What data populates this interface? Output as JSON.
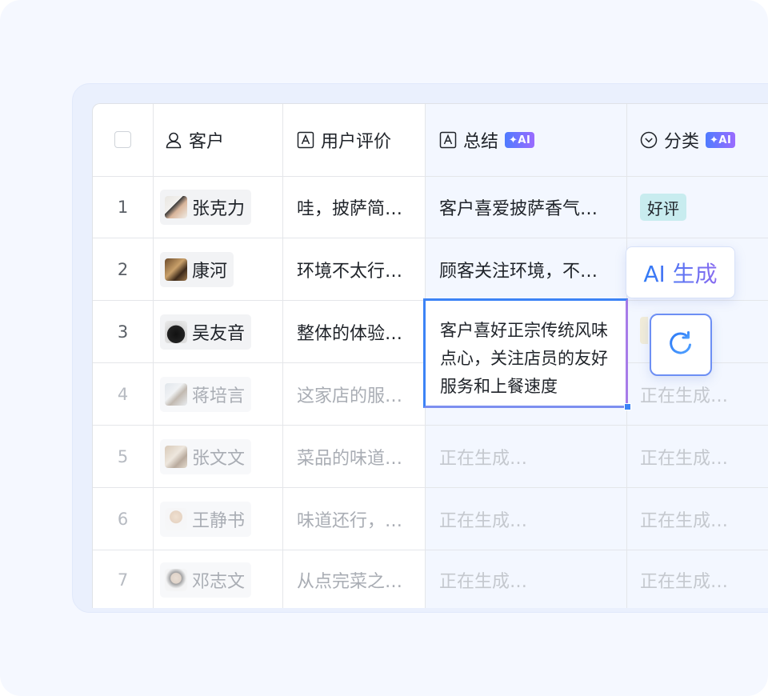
{
  "table": {
    "headers": {
      "customer": "客户",
      "review": "用户评价",
      "summary": "总结",
      "category": "分类",
      "ai_badge": "✦AI"
    },
    "rows": [
      {
        "num": "1",
        "name": "张克力",
        "review": "哇，披萨简…",
        "summary": "客户喜爱披萨香气…",
        "category": "好评"
      },
      {
        "num": "2",
        "name": "康河",
        "review": "环境不太行…",
        "summary": "顾客关注环境，不…",
        "category": ""
      },
      {
        "num": "3",
        "name": "吴友音",
        "review": "整体的体验…",
        "summary": "客户喜好正宗传统风味点心，关注店员的友好服务和上餐速度",
        "category": ""
      },
      {
        "num": "4",
        "name": "蒋培言",
        "review": "这家店的服…",
        "summary": "",
        "category": "正在生成…"
      },
      {
        "num": "5",
        "name": "张文文",
        "review": "菜品的味道…",
        "summary": "正在生成…",
        "category": "正在生成…"
      },
      {
        "num": "6",
        "name": "王静书",
        "review": "味道还行，…",
        "summary": "正在生成…",
        "category": "正在生成…"
      },
      {
        "num": "7",
        "name": "邓志文",
        "review": "从点完菜之…",
        "summary": "正在生成…",
        "category": "正在生成…"
      }
    ]
  },
  "popover": {
    "ai_generate_label": "AI 生成",
    "retry_icon": "refresh-icon"
  },
  "colors": {
    "accent": "#3c83f6",
    "ai_gradient_start": "#4e7bff",
    "ai_gradient_end": "#9a6bff",
    "tag_positive_bg": "#c8ecef",
    "ai_column_bg": "#f3f7ff"
  }
}
